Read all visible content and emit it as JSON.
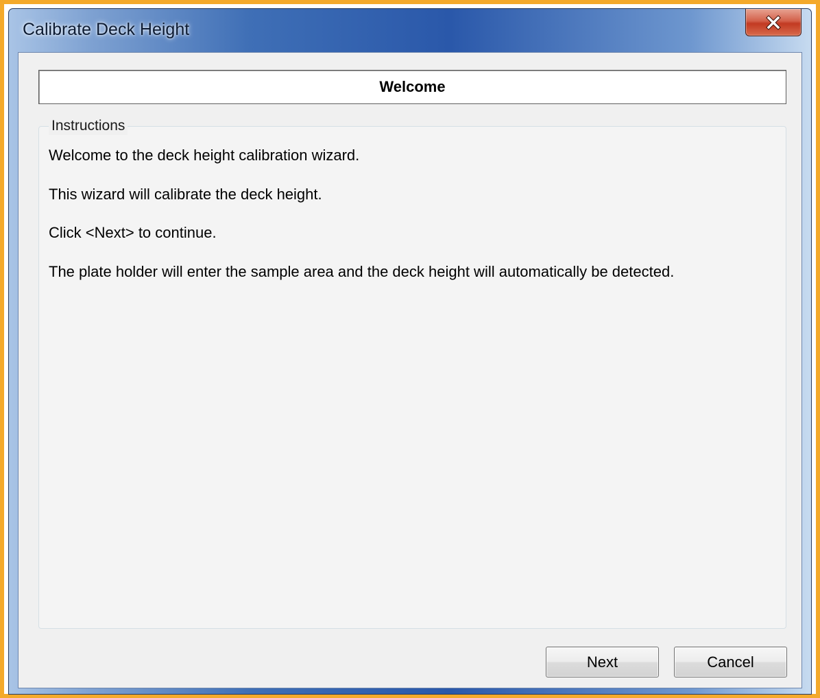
{
  "window": {
    "title": "Calibrate Deck Height",
    "close_icon": "close-x-icon"
  },
  "header": {
    "title": "Welcome"
  },
  "instructions": {
    "legend": "Instructions",
    "lines": [
      "Welcome to the deck height calibration wizard.",
      "This wizard will calibrate the deck height.",
      "Click <Next> to continue.",
      "The plate holder will enter the sample area and the deck height will automatically be detected."
    ]
  },
  "buttons": {
    "next_label": "Next",
    "cancel_label": "Cancel"
  },
  "colors": {
    "frame_highlight": "#f4a92a",
    "titlebar": "#2a58aa",
    "close_button": "#c23a22",
    "client_background": "#f0f0f0"
  }
}
